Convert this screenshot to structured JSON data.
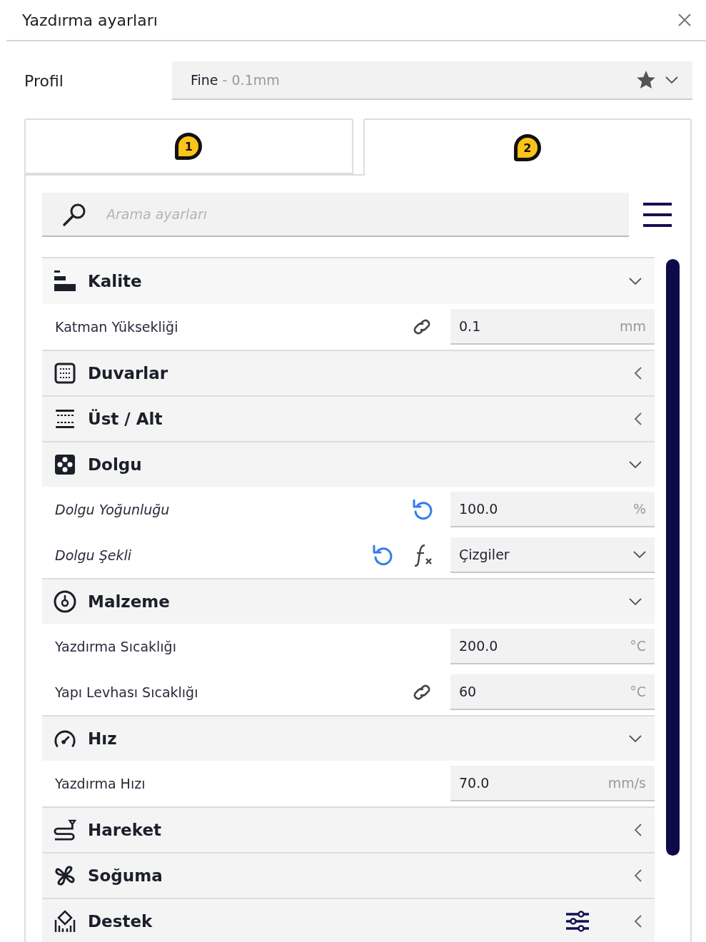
{
  "window": {
    "title": "Yazdırma ayarları"
  },
  "profile": {
    "label": "Profil",
    "value": "Fine",
    "detail": "- 0.1mm",
    "favorite": true
  },
  "tabs": [
    {
      "badge": "1",
      "selected": false
    },
    {
      "badge": "2",
      "selected": true
    }
  ],
  "search": {
    "placeholder": "Arama ayarları"
  },
  "rows": [
    {
      "kind": "category",
      "label": "Kalite",
      "expanded": true,
      "configurable": false
    },
    {
      "kind": "setting",
      "label": "Katman Yüksekliği",
      "modified": false,
      "linked": true,
      "resettable": false,
      "has_formula": false,
      "field": {
        "kind": "number",
        "value": "0.1",
        "unit": "mm"
      }
    },
    {
      "kind": "category",
      "label": "Duvarlar",
      "expanded": false,
      "configurable": false
    },
    {
      "kind": "category",
      "label": "Üst / Alt",
      "expanded": false,
      "configurable": false
    },
    {
      "kind": "category",
      "label": "Dolgu",
      "expanded": true,
      "configurable": false
    },
    {
      "kind": "setting",
      "label": "Dolgu Yoğunluğu",
      "modified": true,
      "linked": false,
      "resettable": true,
      "has_formula": false,
      "field": {
        "kind": "number",
        "value": "100.0",
        "unit": "%"
      }
    },
    {
      "kind": "setting",
      "label": "Dolgu Şekli",
      "modified": true,
      "linked": false,
      "resettable": true,
      "has_formula": true,
      "field": {
        "kind": "dropdown",
        "value": "Çizgiler"
      }
    },
    {
      "kind": "category",
      "label": "Malzeme",
      "expanded": true,
      "configurable": false
    },
    {
      "kind": "setting",
      "label": "Yazdırma Sıcaklığı",
      "modified": false,
      "linked": false,
      "resettable": false,
      "has_formula": false,
      "field": {
        "kind": "number",
        "value": "200.0",
        "unit": "°C"
      }
    },
    {
      "kind": "setting",
      "label": "Yapı Levhası Sıcaklığı",
      "modified": false,
      "linked": true,
      "resettable": false,
      "has_formula": false,
      "field": {
        "kind": "number",
        "value": "60",
        "unit": "°C"
      }
    },
    {
      "kind": "category",
      "label": "Hız",
      "expanded": true,
      "configurable": false
    },
    {
      "kind": "setting",
      "label": "Yazdırma Hızı",
      "modified": false,
      "linked": false,
      "resettable": false,
      "has_formula": false,
      "field": {
        "kind": "number",
        "value": "70.0",
        "unit": "mm/s"
      }
    },
    {
      "kind": "category",
      "label": "Hareket",
      "expanded": false,
      "configurable": false
    },
    {
      "kind": "category",
      "label": "Soğuma",
      "expanded": false,
      "configurable": false
    },
    {
      "kind": "category",
      "label": "Destek",
      "expanded": false,
      "configurable": true
    }
  ]
}
